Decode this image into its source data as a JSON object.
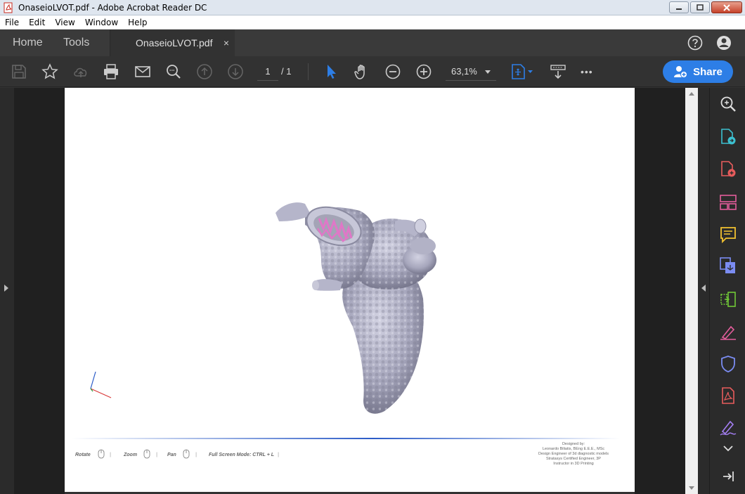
{
  "window": {
    "title": "OnaseioLVOT.pdf - Adobe Acrobat Reader DC"
  },
  "menu": {
    "items": [
      "File",
      "Edit",
      "View",
      "Window",
      "Help"
    ]
  },
  "tabs": {
    "home": "Home",
    "tools": "Tools",
    "document": "OnaseioLVOT.pdf",
    "close_glyph": "×"
  },
  "toolbar": {
    "current_page": "1",
    "page_total": "/ 1",
    "zoom": "63,1%",
    "share_label": "Share",
    "more_glyph": "•••"
  },
  "footer3d": {
    "rotate": "Rotate",
    "zoom": "Zoom",
    "pan": "Pan",
    "fullscreen": "Full Screen Mode:  CTRL + L",
    "designer_lines": [
      "Designed by:",
      "Leonardo Biliatis, BEng E.E.E., MSc",
      "Design Engineer of 3d diagnostic models",
      "Stratasys Certified Engineer, 3P",
      "Instructor in 3D Printing"
    ]
  },
  "colors": {
    "accent": "#2d7ee6",
    "chrome_bg": "#323232",
    "tabbar_bg": "#3a3a3a"
  }
}
